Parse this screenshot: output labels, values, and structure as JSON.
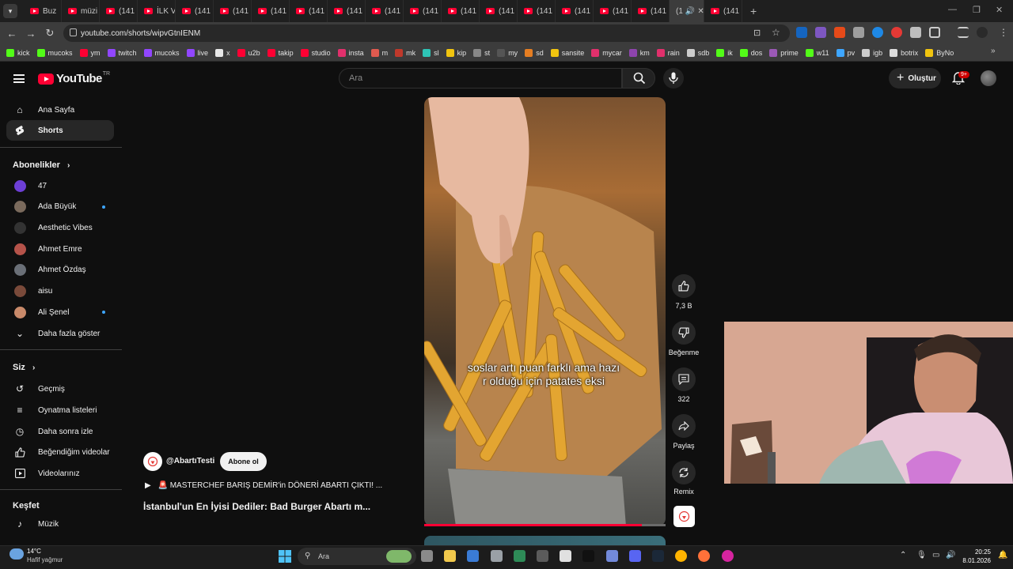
{
  "browser": {
    "tabs": [
      "Buz",
      "müzi",
      "(141",
      "İLK V",
      "(141",
      "(141",
      "(141",
      "(141",
      "(141",
      "(141",
      "(141",
      "(141",
      "(141",
      "(141",
      "(141",
      "(141",
      "(141",
      "(141",
      "(141"
    ],
    "active_tab_label": "(1",
    "url": "youtube.com/shorts/wipvGtnIENM",
    "bookmarks": [
      {
        "label": "kick",
        "color": "#53fc18"
      },
      {
        "label": "mucoks",
        "color": "#53fc18"
      },
      {
        "label": "ym",
        "color": "#ff0033"
      },
      {
        "label": "twitch",
        "color": "#9146ff"
      },
      {
        "label": "mucoks",
        "color": "#9146ff"
      },
      {
        "label": "live",
        "color": "#9146ff"
      },
      {
        "label": "x",
        "color": "#e7e7e7"
      },
      {
        "label": "u2b",
        "color": "#ff0033"
      },
      {
        "label": "takip",
        "color": "#ff0033"
      },
      {
        "label": "studio",
        "color": "#ff0033"
      },
      {
        "label": "insta",
        "color": "#e1306c"
      },
      {
        "label": "m",
        "color": "#e05a4f"
      },
      {
        "label": "mk",
        "color": "#c0392b"
      },
      {
        "label": "sl",
        "color": "#2ec4b6"
      },
      {
        "label": "kip",
        "color": "#f1c40f"
      },
      {
        "label": "st",
        "color": "#888888"
      },
      {
        "label": "my",
        "color": "#555555"
      },
      {
        "label": "sd",
        "color": "#e67e22"
      },
      {
        "label": "sansite",
        "color": "#f1c40f"
      },
      {
        "label": "mycar",
        "color": "#e1306c"
      },
      {
        "label": "km",
        "color": "#8e44ad"
      },
      {
        "label": "rain",
        "color": "#e1306c"
      },
      {
        "label": "sdb",
        "color": "#cccccc"
      },
      {
        "label": "ik",
        "color": "#53fc18"
      },
      {
        "label": "dos",
        "color": "#53fc18"
      },
      {
        "label": "prime",
        "color": "#9b59b6"
      },
      {
        "label": "w11",
        "color": "#53fc18"
      },
      {
        "label": "pv",
        "color": "#3ea6ff"
      },
      {
        "label": "igb",
        "color": "#cccccc"
      },
      {
        "label": "botrix",
        "color": "#dddddd"
      },
      {
        "label": "ByNo",
        "color": "#f1c40f"
      }
    ]
  },
  "youtube": {
    "logo_text": "YouTube",
    "logo_region": "TR",
    "search_placeholder": "Ara",
    "create_label": "Oluştur",
    "notification_badge": "9+"
  },
  "sidebar": {
    "main": [
      {
        "label": "Ana Sayfa",
        "icon": "home-icon",
        "active": false
      },
      {
        "label": "Shorts",
        "icon": "shorts-icon",
        "active": true
      }
    ],
    "subscriptions_header": "Abonelikler",
    "subscriptions": [
      {
        "label": "47",
        "color": "#6d3fd6",
        "new": false
      },
      {
        "label": "Ada Büyük",
        "color": "#7a6a5c",
        "new": true
      },
      {
        "label": "Aesthetic Vibes",
        "color": "#333333",
        "new": false
      },
      {
        "label": "Ahmet Emre",
        "color": "#b5534a",
        "new": false
      },
      {
        "label": "Ahmet Özdaş",
        "color": "#6a6f77",
        "new": false
      },
      {
        "label": "aisu",
        "color": "#7a4a3a",
        "new": false
      },
      {
        "label": "Ali Şenel",
        "color": "#c98a6a",
        "new": true
      }
    ],
    "show_more": "Daha fazla göster",
    "you_header": "Siz",
    "you": [
      {
        "label": "Geçmiş",
        "icon": "history-icon"
      },
      {
        "label": "Oynatma listeleri",
        "icon": "playlists-icon"
      },
      {
        "label": "Daha sonra izle",
        "icon": "watch-later-icon"
      },
      {
        "label": "Beğendiğim videolar",
        "icon": "liked-videos-icon"
      },
      {
        "label": "Videolarınız",
        "icon": "your-videos-icon"
      }
    ],
    "explore_header": "Keşfet",
    "explore": [
      {
        "label": "Müzik",
        "icon": "music-icon"
      }
    ]
  },
  "short": {
    "caption_line1": "soslar artı puan farklı ama hazı",
    "caption_line2": "r olduğu için patates eksi",
    "channel": "@AbartıTesti",
    "subscribe_label": "Abone ol",
    "playlist": "🚨 MASTERCHEF BARIŞ DEMİR'in DÖNERİ ABARTI ÇIKTI! ...",
    "title": "İstanbul'un En İyisi Dediler: Bad Burger Abartı m...",
    "progress_fraction": 0.9
  },
  "actions": {
    "likes": "7,3 B",
    "dislike_label": "Beğenme",
    "comments": "322",
    "share_label": "Paylaş",
    "remix_label": "Remix"
  },
  "taskbar": {
    "temperature": "14°C",
    "weather": "Hafif yağmur",
    "search_label": "Ara",
    "time": "20:25",
    "date": "8.01.2026"
  }
}
